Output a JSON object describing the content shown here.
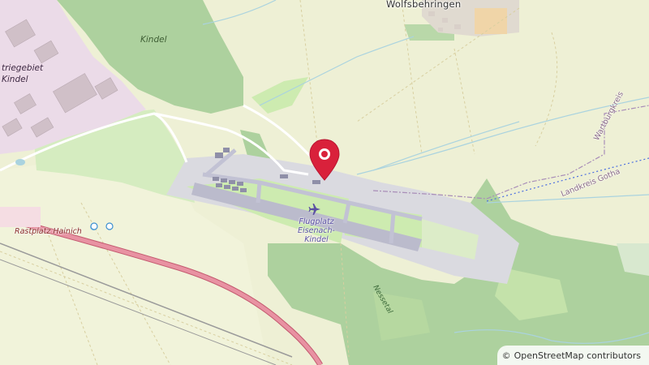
{
  "map": {
    "labels": {
      "forest": "Kindel",
      "village": "Wolfsbehringen",
      "industrial_line1": "triegebiet",
      "industrial_line2": "Kindel",
      "rest_area": "Rastplatz Hainich",
      "airport_line1": "Flugplatz",
      "airport_line2": "Eisenach-",
      "airport_line3": "Kindel",
      "boundary_1": "Wartburgkreis",
      "boundary_2": "Landkreis Gotha",
      "stream": "Nessetal"
    },
    "marker": {
      "icon": "map-pin-icon",
      "color": "#d9213b"
    },
    "airport_icon": "airplane-icon",
    "attribution": {
      "symbol": "©",
      "text": "OpenStreetMap contributors"
    },
    "colors": {
      "farmland": "#eef0d5",
      "forest": "#add19e",
      "grass": "#cdebb0",
      "industrial": "#ebdbe8",
      "apron": "#dadae0",
      "runway": "#bbbbcc",
      "motorway": "#e892a2"
    }
  }
}
